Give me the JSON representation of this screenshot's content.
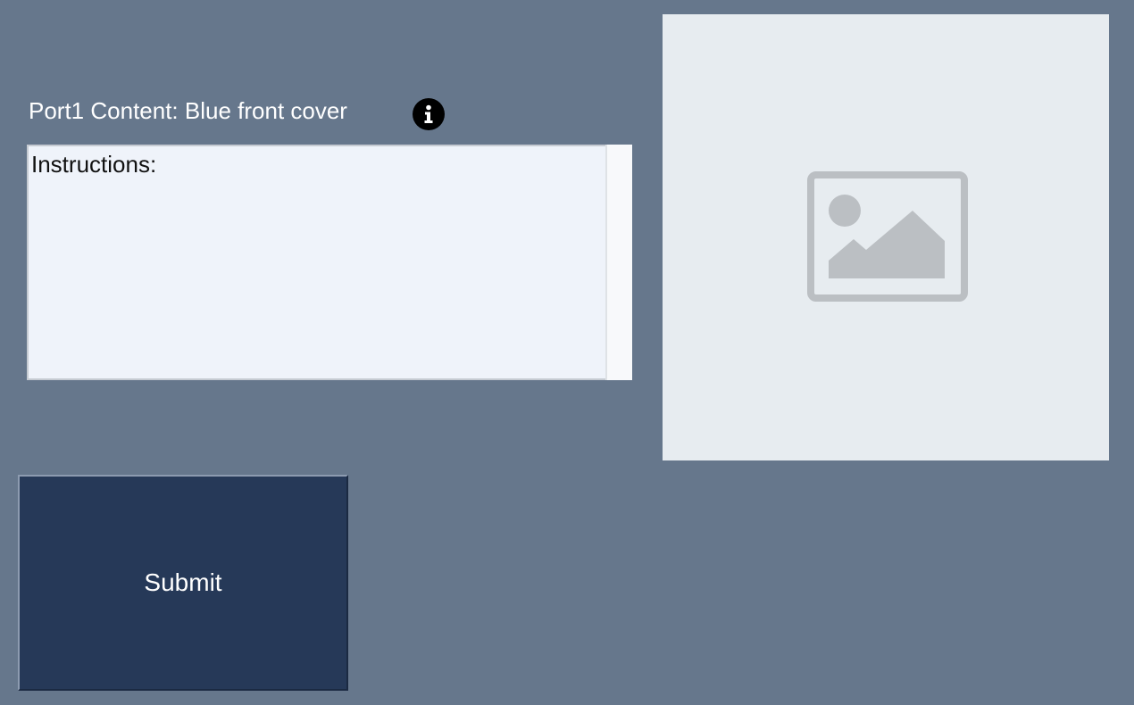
{
  "header": {
    "port_label": "Port1 Content: Blue front cover",
    "info_icon": "info-icon"
  },
  "instructions": {
    "label": "Instructions:"
  },
  "preview": {
    "icon": "image-placeholder-icon"
  },
  "actions": {
    "submit_label": "Submit"
  },
  "colors": {
    "background": "#66778c",
    "instructions_bg": "#eff3fa",
    "image_panel_bg": "#e7ecf0",
    "submit_bg": "#263958",
    "placeholder_icon": "#bbbfc3"
  }
}
